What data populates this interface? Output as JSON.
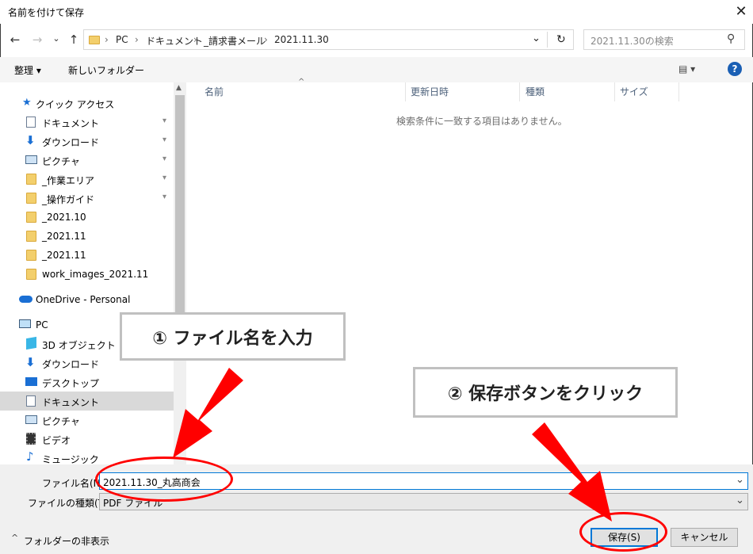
{
  "window": {
    "title": "名前を付けて保存",
    "close": "✕"
  },
  "nav": {
    "back": "←",
    "forward": "→",
    "recent": "⌄",
    "up": "↑",
    "breadcrumb": [
      "PC",
      "ドキュメント",
      "_請求書メール",
      "2021.11.30"
    ],
    "sep": "›",
    "dropdown": "⌄",
    "refresh": "↻",
    "search_placeholder": "2021.11.30の検索",
    "search_icon": "⚲"
  },
  "toolbar": {
    "organize": "整理 ▾",
    "new_folder": "新しいフォルダー",
    "view": "▤ ▾",
    "help": "?"
  },
  "sidebar": {
    "quick_access": "クイック アクセス",
    "quick_items": [
      "ドキュメント",
      "ダウンロード",
      "ピクチャ",
      "_作業エリア",
      "_操作ガイド",
      "_2021.10",
      "_2021.11",
      "_2021.11",
      "work_images_2021.11"
    ],
    "onedrive": "OneDrive - Personal",
    "pc": "PC",
    "pc_items": [
      "3D オブジェクト",
      "ダウンロード",
      "デスクトップ",
      "ドキュメント",
      "ピクチャ",
      "ビデオ",
      "ミュージック"
    ],
    "pin": "📌"
  },
  "filelist": {
    "columns": [
      "名前",
      "更新日時",
      "種類",
      "サイズ"
    ],
    "sort_arrow": "^",
    "empty_message": "検索条件に一致する項目はありません。"
  },
  "form": {
    "filename_label": "ファイル名(N):",
    "filename_value": "2021.11.30_丸高商会",
    "filetype_label": "ファイルの種類(T):",
    "filetype_value": "PDF ファイル",
    "chevron": "⌄",
    "hide_folders": "フォルダーの非表示",
    "hide_arrow": "^",
    "save": "保存(S)",
    "cancel": "キャンセル"
  },
  "annotations": {
    "step1": "① ファイル名を入力",
    "step2": "② 保存ボタンをクリック"
  },
  "colors": {
    "accent": "#0078d7",
    "annotation_red": "#ff0000",
    "callout_border": "#c0c0c0"
  }
}
